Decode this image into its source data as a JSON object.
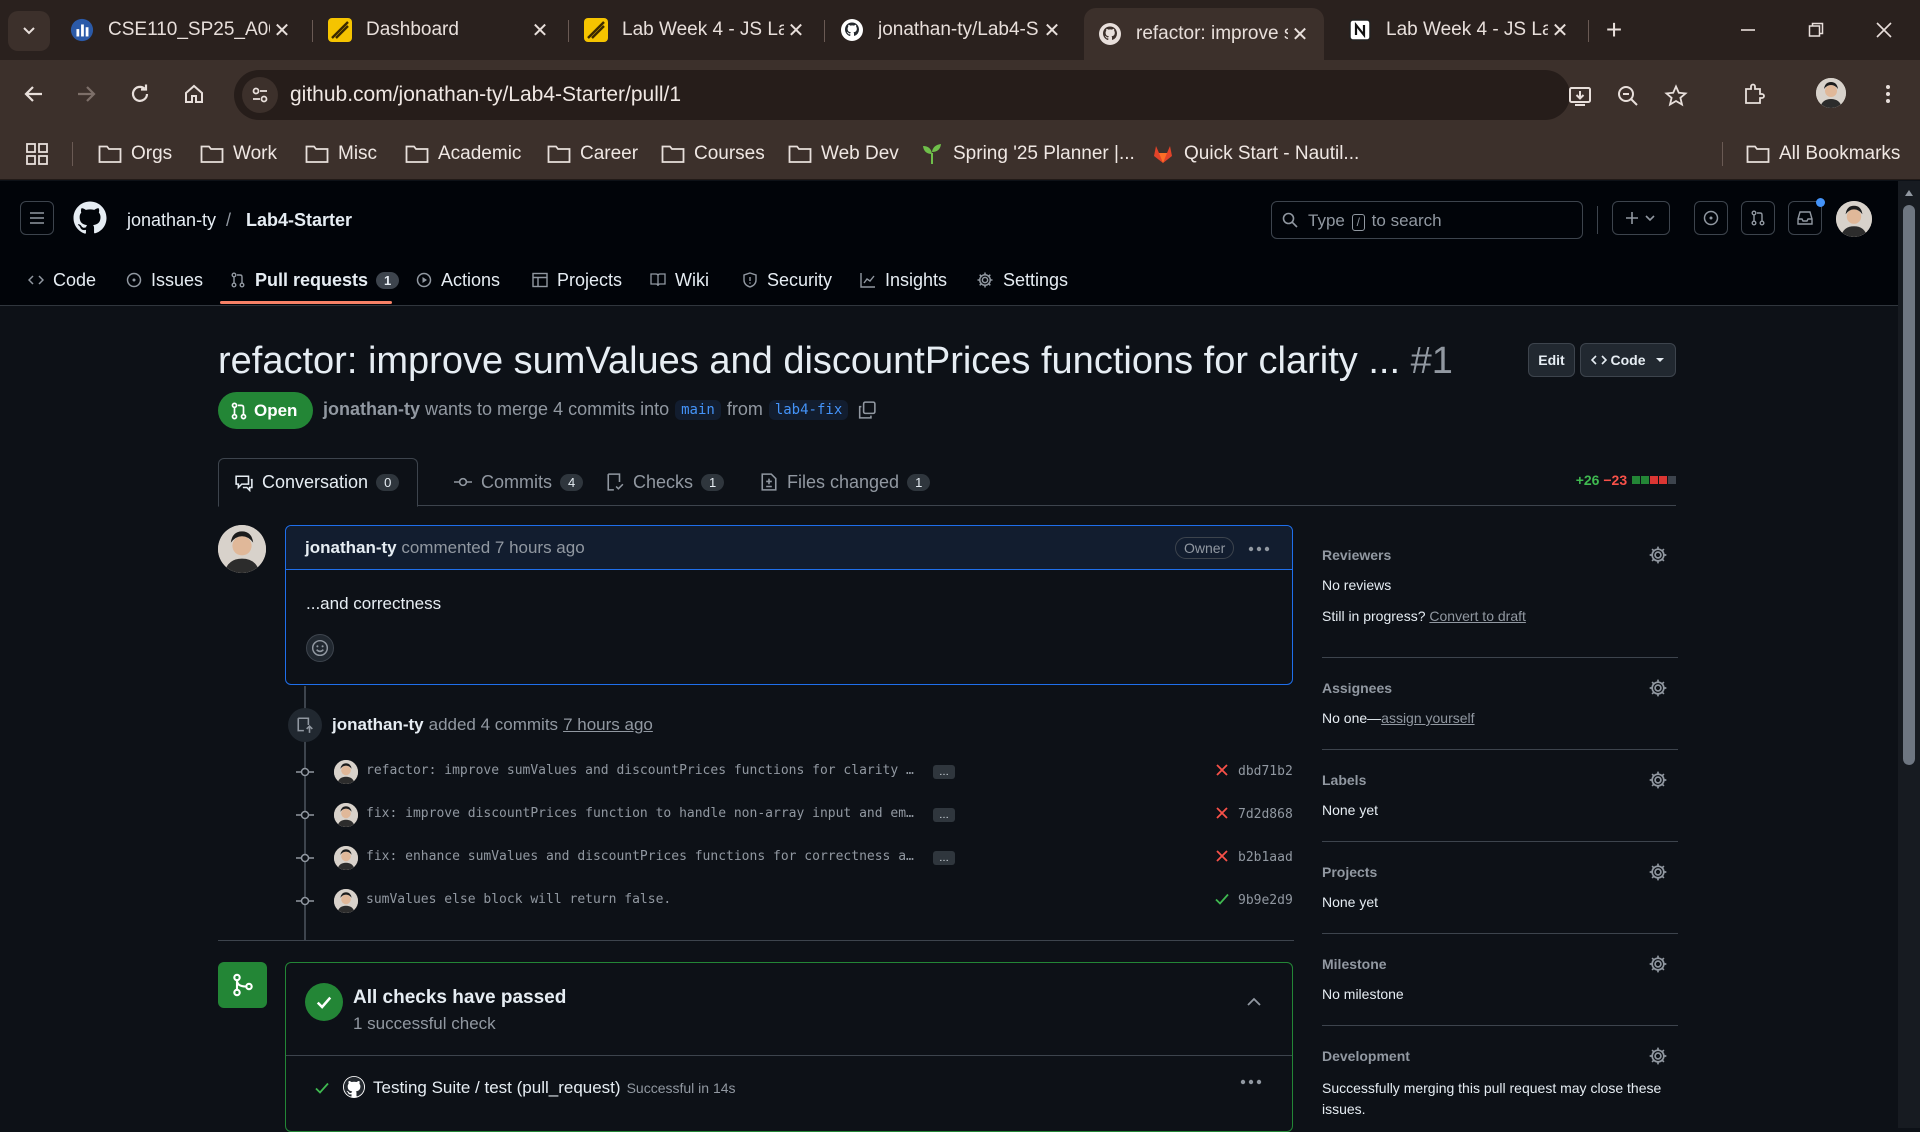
{
  "browser": {
    "tabs": [
      {
        "title": "CSE110_SP25_A00",
        "favicon": "chart-icon"
      },
      {
        "title": "Dashboard",
        "favicon": "canvas-icon"
      },
      {
        "title": "Lab Week 4 - JS La",
        "favicon": "canvas-icon"
      },
      {
        "title": "jonathan-ty/Lab4-S",
        "favicon": "github-icon"
      },
      {
        "title": "refactor: improve s",
        "favicon": "github-pr-icon"
      },
      {
        "title": "Lab Week 4 - JS La",
        "favicon": "notion-icon"
      }
    ],
    "url": "github.com/jonathan-ty/Lab4-Starter/pull/1",
    "bookmarks": [
      "Orgs",
      "Work",
      "Misc",
      "Academic",
      "Career",
      "Courses",
      "Web Dev",
      "Spring '25 Planner |...",
      "Quick Start - Nautil..."
    ],
    "all_bookmarks": "All Bookmarks"
  },
  "header": {
    "owner": "jonathan-ty",
    "separator": "/",
    "repo": "Lab4-Starter",
    "search_placeholder_pre": "Type",
    "search_key": "/",
    "search_placeholder_post": "to search",
    "nav": [
      {
        "label": "Code",
        "icon": "code-icon"
      },
      {
        "label": "Issues",
        "icon": "issue-icon"
      },
      {
        "label": "Pull requests",
        "icon": "pull-request-icon",
        "count": "1"
      },
      {
        "label": "Actions",
        "icon": "play-icon"
      },
      {
        "label": "Projects",
        "icon": "table-icon"
      },
      {
        "label": "Wiki",
        "icon": "book-icon"
      },
      {
        "label": "Security",
        "icon": "shield-icon"
      },
      {
        "label": "Insights",
        "icon": "graph-icon"
      },
      {
        "label": "Settings",
        "icon": "gear-icon"
      }
    ]
  },
  "pr": {
    "title": "refactor: improve sumValues and discountPrices functions for clarity ...",
    "number": "#1",
    "edit_label": "Edit",
    "code_label": "Code",
    "state": "Open",
    "author": "jonathan-ty",
    "merge_text": "wants to merge 4 commits into",
    "base": "main",
    "from_text": "from",
    "head": "lab4-fix",
    "tabs": [
      {
        "label": "Conversation",
        "count": "0"
      },
      {
        "label": "Commits",
        "count": "4"
      },
      {
        "label": "Checks",
        "count": "1"
      },
      {
        "label": "Files changed",
        "count": "1"
      }
    ],
    "additions": "+26",
    "deletions": "−23"
  },
  "comment": {
    "author": "jonathan-ty",
    "action": "commented 7 hours ago",
    "badge": "Owner",
    "body": "...and correctness"
  },
  "commit_event": {
    "author": "jonathan-ty",
    "action": "added 4 commits",
    "time": "7 hours ago"
  },
  "commits": [
    {
      "message": "refactor: improve sumValues and discountPrices functions for clarity …",
      "sha": "dbd71b2",
      "status": "fail",
      "more": "…"
    },
    {
      "message": "fix: improve discountPrices function to handle non-array input and em…",
      "sha": "7d2d868",
      "status": "fail",
      "more": "…"
    },
    {
      "message": "fix: enhance sumValues and discountPrices functions for correctness a…",
      "sha": "b2b1aad",
      "status": "fail",
      "more": "…"
    },
    {
      "message": "sumValues else block will return false.",
      "sha": "9b9e2d9",
      "status": "pass"
    }
  ],
  "checks": {
    "title": "All checks have passed",
    "subtitle": "1 successful check",
    "row_name": "Testing Suite / test (pull_request)",
    "row_status": "Successful in 14s"
  },
  "sidebar": {
    "reviewers": {
      "title": "Reviewers",
      "value": "No reviews",
      "line2_pre": "Still in progress?",
      "line2_link": "Convert to draft"
    },
    "assignees": {
      "title": "Assignees",
      "value_pre": "No one—",
      "value_link": "assign yourself"
    },
    "labels": {
      "title": "Labels",
      "value": "None yet"
    },
    "projects": {
      "title": "Projects",
      "value": "None yet"
    },
    "milestone": {
      "title": "Milestone",
      "value": "No milestone"
    },
    "development": {
      "title": "Development",
      "value": "Successfully merging this pull request may close these issues."
    }
  },
  "colors": {
    "success": "#238636",
    "danger": "#f85149",
    "accent": "#1f6feb",
    "link": "#4493f8"
  }
}
